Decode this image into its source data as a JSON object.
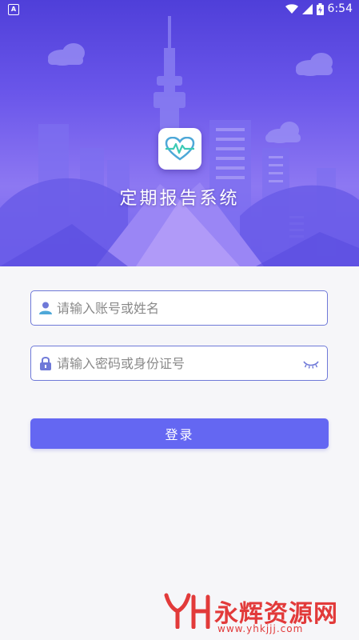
{
  "status_bar": {
    "left_icon": "A",
    "time": "6:54",
    "battery_icon": "battery-charging-icon",
    "wifi_icon": "wifi-icon",
    "signal_icon": "signal-icon"
  },
  "app": {
    "title": "定期报告系统",
    "logo_icon": "heart-pulse-icon"
  },
  "form": {
    "username": {
      "value": "",
      "placeholder": "请输入账号或姓名",
      "icon": "user-icon"
    },
    "password": {
      "value": "",
      "placeholder": "请输入密码或身份证号",
      "icon": "lock-icon",
      "toggle_icon": "eye-closed-icon"
    },
    "login_label": "登录"
  },
  "watermark": {
    "text": "永辉资源网",
    "url": "www.yhkjjj.com"
  },
  "colors": {
    "accent": "#6467f2",
    "hero_top": "#4f3fd9",
    "field_border": "#6f79d8",
    "watermark": "#e23a3a"
  }
}
